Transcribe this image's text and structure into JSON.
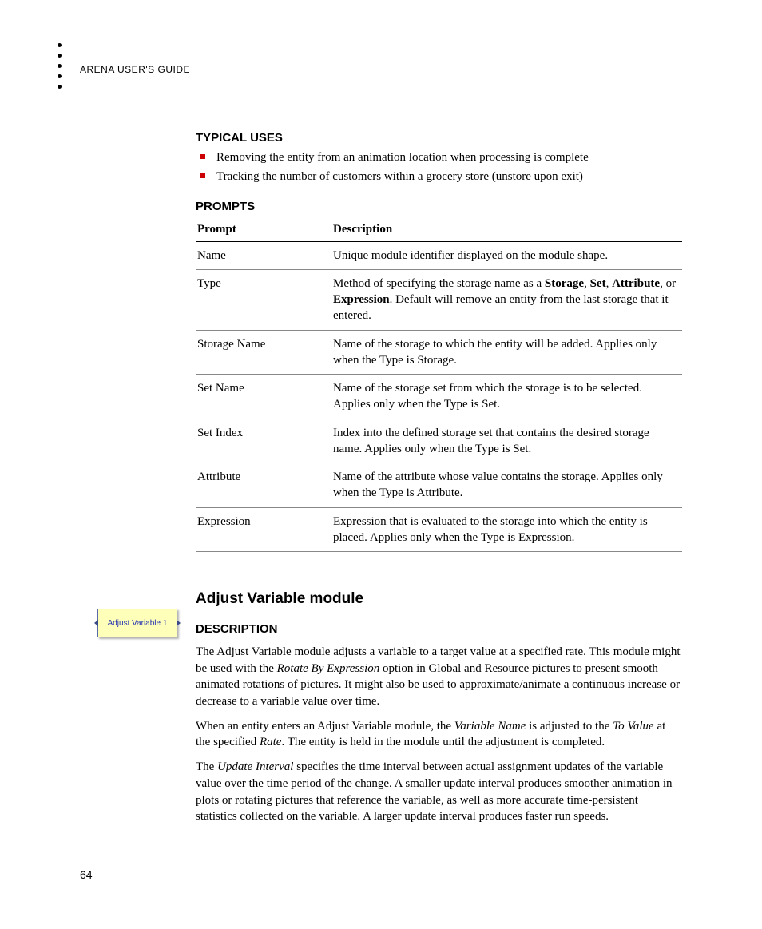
{
  "running_head": "ARENA USER'S GUIDE",
  "page_number": "64",
  "typical_uses": {
    "heading": "TYPICAL USES",
    "items": [
      "Removing the entity from an animation location when processing is complete",
      "Tracking the number of customers within a grocery store (unstore upon exit)"
    ]
  },
  "prompts": {
    "heading": "PROMPTS",
    "col_prompt": "Prompt",
    "col_desc": "Description",
    "rows": [
      {
        "prompt": "Name",
        "desc": "Unique module identifier displayed on the module shape."
      },
      {
        "prompt": "Type",
        "desc_pre": "Method of specifying the storage name as a ",
        "bold1": "Storage",
        "sep1": ", ",
        "bold2": "Set",
        "sep2": ", ",
        "bold3": "Attribute",
        "sep3": ", or ",
        "bold4": "Expression",
        "desc_post": ". Default will remove an entity from the last storage that it entered."
      },
      {
        "prompt": "Storage Name",
        "desc": "Name of the storage to which the entity will be added. Applies only when the Type is Storage."
      },
      {
        "prompt": "Set Name",
        "desc": "Name of the storage set from which the storage is to be selected. Applies only when the Type is Set."
      },
      {
        "prompt": "Set Index",
        "desc": "Index into the defined storage set that contains the desired storage name. Applies only when the Type is Set."
      },
      {
        "prompt": "Attribute",
        "desc": "Name of the attribute whose value contains the storage. Applies only when the Type is Attribute."
      },
      {
        "prompt": "Expression",
        "desc": "Expression that is evaluated to the storage into which the entity is placed. Applies only when the Type is Expression."
      }
    ]
  },
  "module": {
    "title": "Adjust Variable module",
    "icon_label": "Adjust Variable 1",
    "desc_heading": "DESCRIPTION",
    "para1_pre": "The Adjust Variable module adjusts a variable to a target value at a specified rate. This module might be used with the ",
    "para1_italic": "Rotate By Expression",
    "para1_post": " option in Global and Resource pictures to present smooth animated rotations of pictures. It might also be used to approximate/animate a continuous increase or decrease to a variable value over time.",
    "para2_pre": "When an entity enters an Adjust Variable module, the ",
    "para2_i1": "Variable Name",
    "para2_mid1": " is adjusted to the ",
    "para2_i2": "To Value",
    "para2_mid2": " at the specified ",
    "para2_i3": "Rate",
    "para2_post": ". The entity is held in the module until the adjustment is completed.",
    "para3_pre": "The ",
    "para3_italic": "Update Interval",
    "para3_post": " specifies the time interval between actual assignment updates of the variable value over the time period of the change. A smaller update interval produces smoother animation in plots or rotating pictures that reference the variable, as well as more accurate time-persistent statistics collected on the variable. A larger update interval produces faster run speeds."
  }
}
